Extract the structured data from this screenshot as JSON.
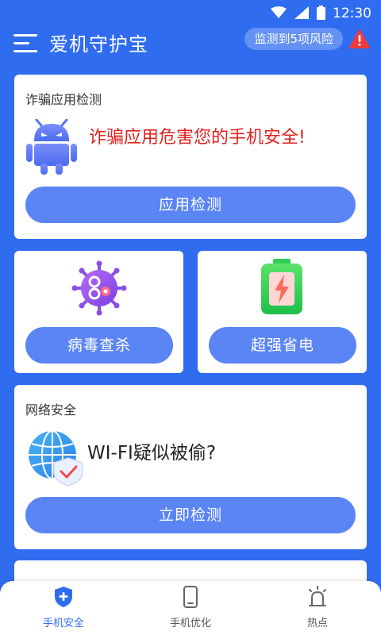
{
  "status_bar": {
    "time": "12:30"
  },
  "header": {
    "title": "爱机守护宝",
    "risk_badge": "监测到5项风险"
  },
  "fraud_card": {
    "title": "诈骗应用检测",
    "message": "诈骗应用危害您的手机安全!",
    "button": "应用检测"
  },
  "virus_card": {
    "button": "病毒查杀"
  },
  "battery_card": {
    "button": "超强省电"
  },
  "network_card": {
    "title": "网络安全",
    "message": "WI-FI疑似被偷?",
    "button": "立即检测"
  },
  "bottom_nav": {
    "items": [
      {
        "label": "手机安全",
        "active": true
      },
      {
        "label": "手机优化",
        "active": false
      },
      {
        "label": "热点",
        "active": false
      }
    ]
  },
  "colors": {
    "brand_blue": "#2f6cf0",
    "button_blue": "#5b85f5",
    "danger_red": "#e0221d",
    "active_nav": "#2f6cf0",
    "inactive_nav": "#555555"
  }
}
